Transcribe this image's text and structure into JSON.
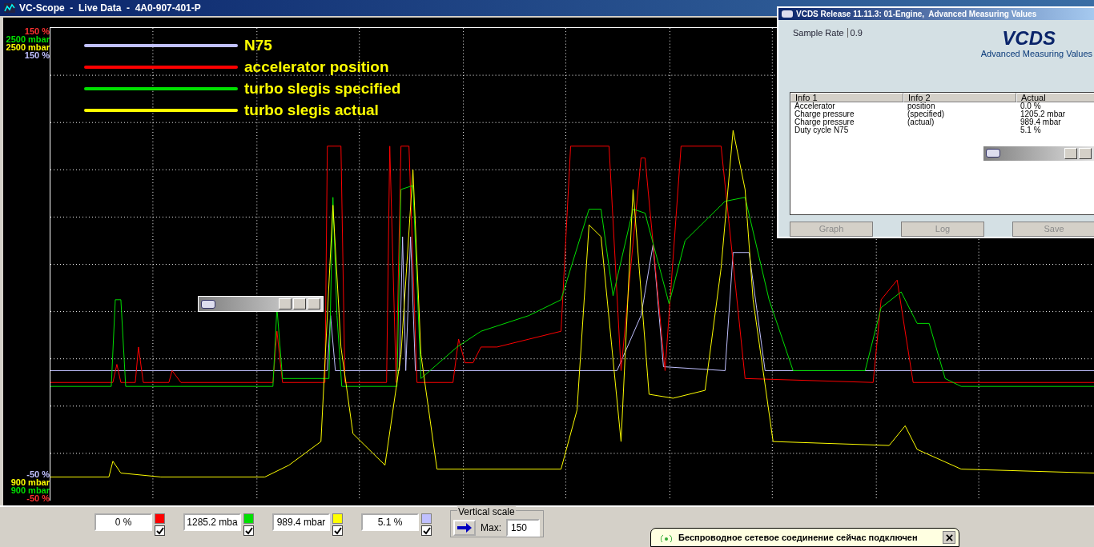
{
  "window": {
    "title": "VC-Scope  -  Live Data  -  4A0-907-401-P"
  },
  "axis_top": [
    {
      "text": "150 %",
      "color": "#ff3030"
    },
    {
      "text": "2500 mbar",
      "color": "#00e000"
    },
    {
      "text": "2500 mbar",
      "color": "#ffff00"
    },
    {
      "text": "150 %",
      "color": "#c0c0ff"
    }
  ],
  "axis_bottom": [
    {
      "text": "-50 %",
      "color": "#c0c0ff"
    },
    {
      "text": "900 mbar",
      "color": "#ffff00"
    },
    {
      "text": "900 mbar",
      "color": "#00e000"
    },
    {
      "text": "-50 %",
      "color": "#ff3030"
    }
  ],
  "legend": [
    {
      "label": "N75",
      "color": "#c0c0ff"
    },
    {
      "label": "accelerator position",
      "color": "#ff0000"
    },
    {
      "label": "turbo slegis specified",
      "color": "#00e000"
    },
    {
      "label": "turbo slegis actual",
      "color": "#ffff00"
    }
  ],
  "channels": [
    {
      "value": "0 %",
      "color": "#ff0000",
      "checked": true
    },
    {
      "value": "1285.2 mba",
      "color": "#00e000",
      "checked": true
    },
    {
      "value": "989.4 mbar",
      "color": "#ffff00",
      "checked": true
    },
    {
      "value": "5.1 %",
      "color": "#c0c0ff",
      "checked": true
    }
  ],
  "vertical_scale": {
    "label": "Vertical scale",
    "max_label": "Max:",
    "max": "150"
  },
  "notification": {
    "text": "Беспроводное сетевое соединение сейчас подключен"
  },
  "vcds": {
    "title": "VCDS Release 11.11.3: 01-Engine,  Advanced Measuring Values",
    "sample_rate_label": "Sample Rate",
    "sample_rate": "0.9",
    "logo": "VCDS",
    "subtitle": "Advanced Measuring Values",
    "columns": [
      "Info 1",
      "Info 2",
      "Actual"
    ],
    "rows": [
      {
        "info1": "Accelerator",
        "info2": "position",
        "actual": "0.0 %"
      },
      {
        "info1": "Charge pressure",
        "info2": "(specified)",
        "actual": "1205.2 mbar"
      },
      {
        "info1": "Charge pressure",
        "info2": "(actual)",
        "actual": "989.4 mbar"
      },
      {
        "info1": "Duty cycle N75",
        "actual": "5.1 %"
      }
    ],
    "buttons": [
      {
        "label": "Graph",
        "disabled": true
      },
      {
        "label": "Log",
        "disabled": true
      },
      {
        "label": "Save",
        "disabled": true
      }
    ]
  }
}
